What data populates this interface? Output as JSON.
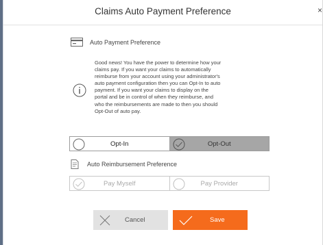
{
  "dialog": {
    "title": "Claims Auto Payment Preference",
    "close_glyph": "×"
  },
  "auto_payment": {
    "section_title": "Auto Payment Preference",
    "icon": "payment-card-icon",
    "info_icon": "info-icon",
    "description": "Good news! You have the power to determine how your claims pay. If you want your claims to automatically reimburse from your account using your administrator's auto payment configuration then you can Opt-In to auto payment. If you want your claims to display on the portal and be in control of when they reimburse, and who the reimbursements are made to then you should Opt-Out of auto pay.",
    "options": [
      {
        "label": "Opt-In",
        "selected": false
      },
      {
        "label": "Opt-Out",
        "selected": true
      }
    ]
  },
  "auto_reimbursement": {
    "section_title": "Auto Reimbursement Preference",
    "icon": "receipt-icon",
    "disabled": true,
    "options": [
      {
        "label": "Pay Myself",
        "selected": true
      },
      {
        "label": "Pay Provider",
        "selected": false
      }
    ]
  },
  "buttons": {
    "cancel_label": "Cancel",
    "save_label": "Save"
  },
  "colors": {
    "accent_save": "#f56b1c",
    "selected_toggle": "#a6a6a6",
    "frame": "#5f6f86"
  }
}
